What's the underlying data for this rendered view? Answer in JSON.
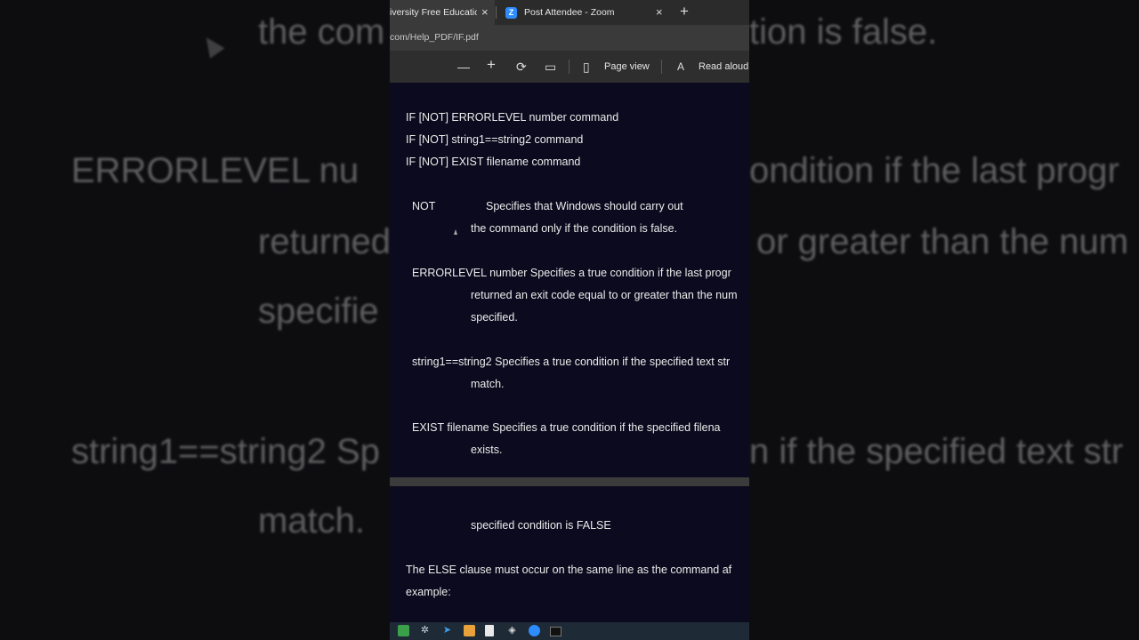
{
  "background": {
    "lines": [
      "the com",
      "tion is false.",
      "ERRORLEVEL nu",
      "ondition if the last progr",
      "returned",
      "or greater than the num",
      "specifie",
      "string1==string2  Sp",
      "n if the specified text str",
      "match."
    ]
  },
  "browser": {
    "tab1_label": "iversity Free Education",
    "tab1_close": "×",
    "tab2_icon": "Z",
    "tab2_label": "Post Attendee - Zoom",
    "tab2_close": "×",
    "newtab": "+",
    "address": "com/Help_PDF/IF.pdf"
  },
  "toolbar": {
    "zoom_out": "—",
    "zoom_in": "+",
    "rotate": "⟳",
    "fit": "▭",
    "page_view_icon": "▯",
    "page_view": "Page view",
    "read_aloud_icon": "A",
    "read_aloud": "Read aloud"
  },
  "document": {
    "syntax": [
      "IF [NOT] ERRORLEVEL number command",
      "IF [NOT] string1==string2 command",
      "IF [NOT] EXIST filename command"
    ],
    "not_term": "NOT",
    "not_desc1": "Specifies that Windows should carry out",
    "not_desc2": "the command only if the condition is false.",
    "errorlevel_line": "ERRORLEVEL number Specifies a true condition if the last progr",
    "errorlevel_desc2": "returned an exit code equal to or greater than the num",
    "errorlevel_desc3": "specified.",
    "string_line": "string1==string2  Specifies a true condition if the specified text str",
    "string_desc2": "match.",
    "exist_line": "EXIST filename    Specifies a true condition if the specified filena",
    "exist_desc2": "exists.",
    "page2_line1": "specified condition is FALSE",
    "page2_line2": "The ELSE clause must occur on the same line as the command af",
    "page2_line3": "example:"
  },
  "colors": {
    "doc_bg": "#0b0a1e",
    "zoom_blue": "#2d8cff"
  }
}
